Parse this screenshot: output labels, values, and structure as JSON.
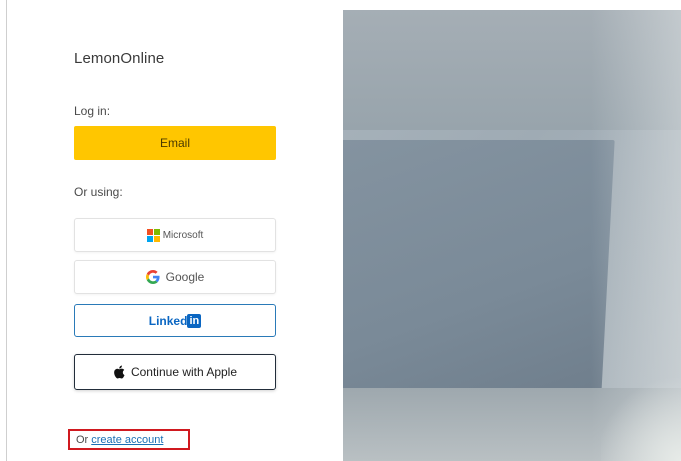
{
  "brand": {
    "name": "LemonOnline"
  },
  "login": {
    "label": "Log in:",
    "email_button": "Email",
    "or_using": "Or using:"
  },
  "providers": {
    "microsoft": "Microsoft",
    "google": "Google",
    "linkedin_text": "Linked",
    "linkedin_box": "in",
    "apple": "Continue with Apple"
  },
  "signup": {
    "prefix": "Or",
    "link": "create account"
  },
  "colors": {
    "email_button": "#ffc600",
    "linkedin": "#0a66c2",
    "link": "#1a6fb5",
    "highlight_border": "#d0191f"
  },
  "icons": {
    "microsoft": "microsoft-logo-icon",
    "google": "google-g-icon",
    "linkedin": "linkedin-logo-icon",
    "apple": "apple-logo-icon"
  }
}
